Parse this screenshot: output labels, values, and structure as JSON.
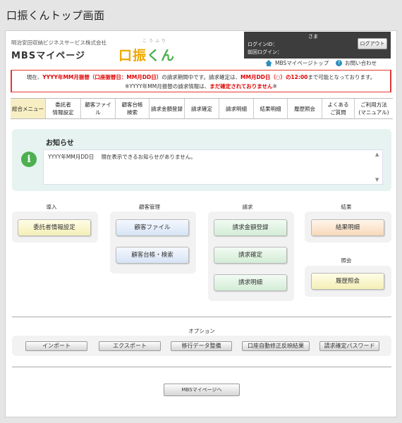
{
  "screen_title": "口振くんトップ画面",
  "header": {
    "company": "明治安田収納ビジネスサービス株式会社",
    "site_name": "MBSマイページ",
    "brand_ruby": "こうふり",
    "brand_logo_a": "口振",
    "brand_logo_b": "くん",
    "user_suffix": "さま",
    "login_id_label": "ログインID：",
    "last_login_label": "前回ログイン：",
    "logout_label": "ログアウト",
    "mypage_top_link": "MBSマイページトップ",
    "contact_link": "お問い合わせ",
    "help_glyph": "?"
  },
  "notice": {
    "line1_a": "現在、",
    "line1_b": "YYYY年MM月振替（口座振替日：MM月DD日）",
    "line1_c": "の請求期間中です。請求確定は、",
    "line1_d": "MM月DD日（○）の12:00",
    "line1_e": "まで可能となっております。",
    "line2_a": "※YYYY年MM月振替の請求情報は、",
    "line2_b": "まだ確定されておりません",
    "line2_c": "※"
  },
  "nav": [
    "総合メニュー",
    "委託者\n情報設定",
    "顧客ファイル",
    "顧客台帳\n検索",
    "請求金額登録",
    "請求確定",
    "請求明細",
    "結果明細",
    "履歴照会",
    "よくある\nご質問",
    "ご利用方法\n(マニュアル)"
  ],
  "info": {
    "title": "お知らせ",
    "icon_glyph": "i",
    "date": "YYYY年MM月DD日",
    "message": "現在表示できるお知らせがありません。",
    "scroll_up": "▲",
    "scroll_down": "▼"
  },
  "groups": {
    "intro": {
      "title": "導入",
      "buttons": [
        "委託者情報設定"
      ]
    },
    "customer": {
      "title": "顧客管理",
      "buttons": [
        "顧客ファイル",
        "顧客台帳・検索"
      ]
    },
    "billing": {
      "title": "請求",
      "buttons": [
        "請求金額登録",
        "請求確定",
        "請求明細"
      ]
    },
    "result": {
      "title": "結果",
      "buttons": [
        "結果明細"
      ]
    },
    "inquiry": {
      "title": "照会",
      "buttons": [
        "履歴照会"
      ]
    }
  },
  "options": {
    "title": "オプション",
    "buttons": [
      "インポート",
      "エクスポート",
      "移行データ整備",
      "口座自動修正反映結果",
      "請求確定パスワード"
    ]
  },
  "footer_button": "MBSマイページへ"
}
